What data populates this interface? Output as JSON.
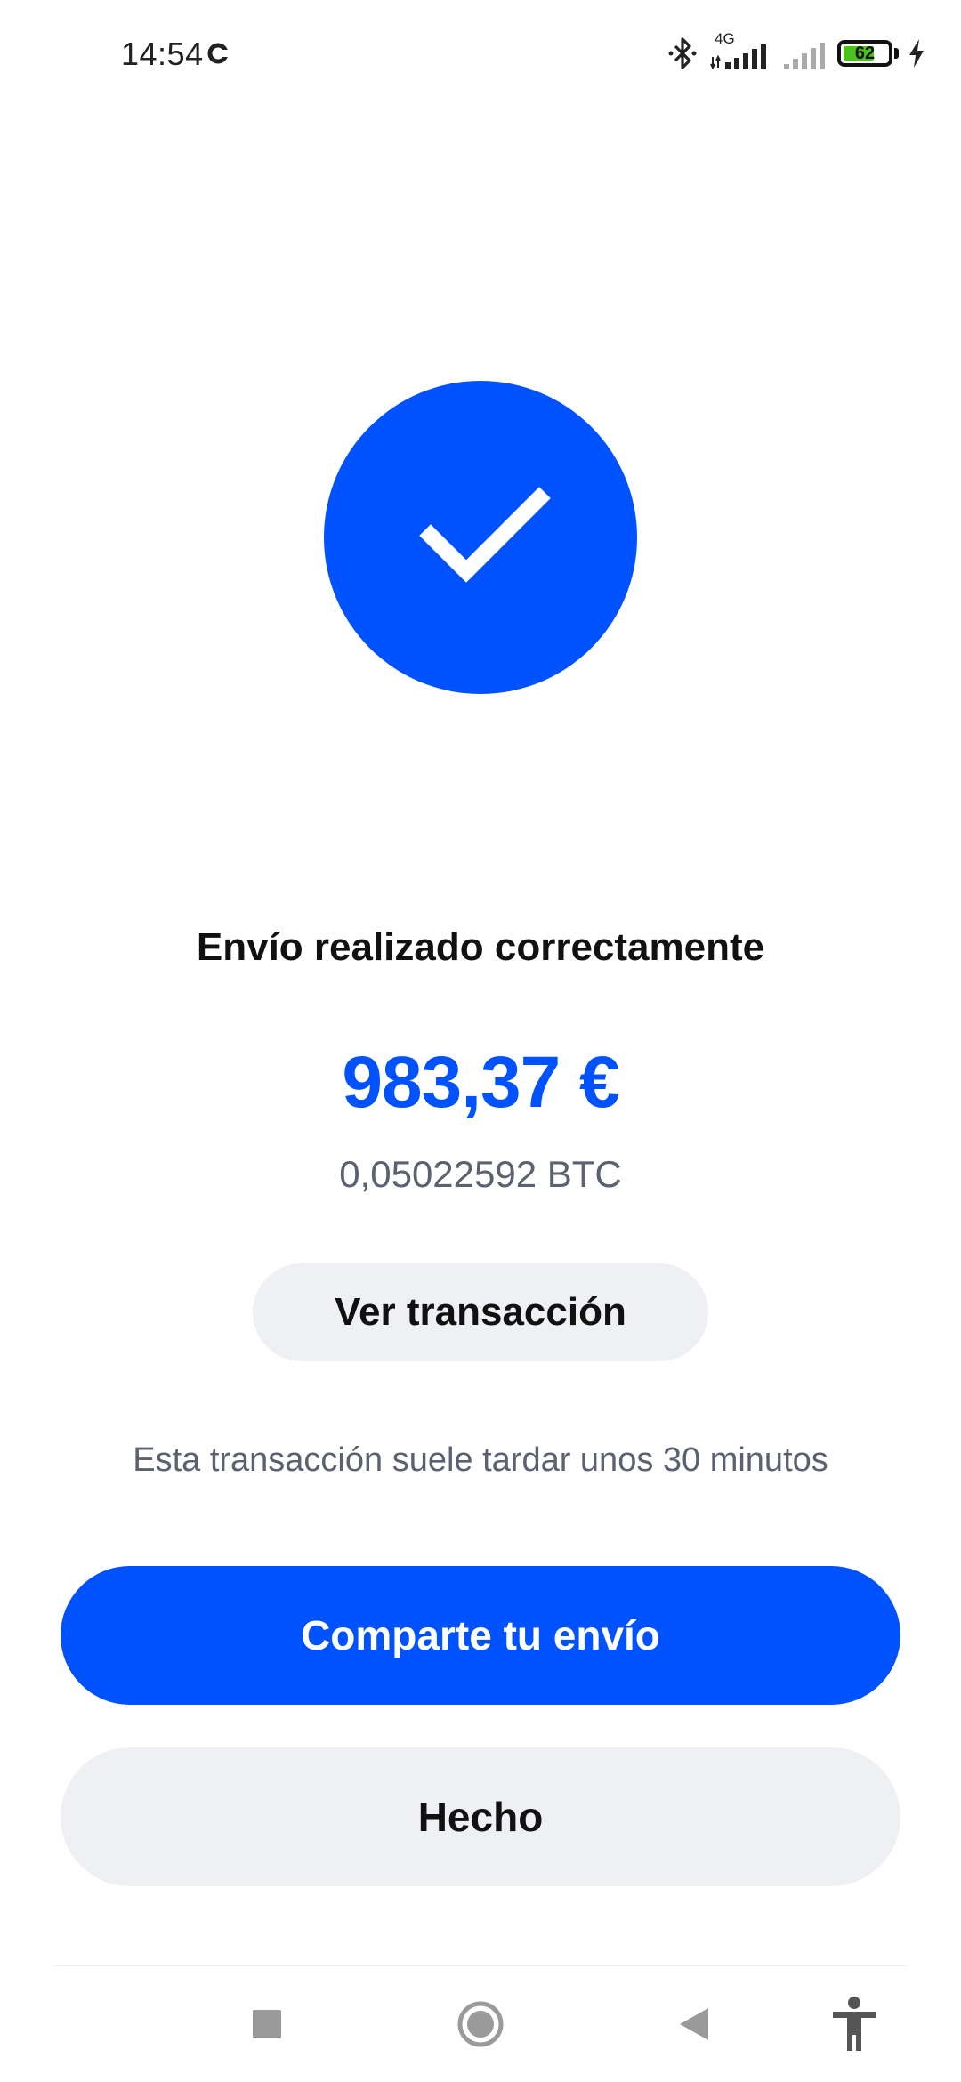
{
  "status_bar": {
    "time": "14:54",
    "network": "4G",
    "battery": "62",
    "icons": [
      "sync-icon",
      "bluetooth-icon",
      "signal-4g-icon",
      "signal-icon",
      "battery-icon",
      "charging-icon"
    ]
  },
  "success": {
    "icon": "checkmark-icon",
    "title": "Envío realizado correctamente",
    "amount_fiat": "983,37 €",
    "amount_crypto": "0,05022592 BTC"
  },
  "actions": {
    "view_transaction": "Ver transacción",
    "info": "Esta transacción suele tardar unos 30 minutos",
    "share": "Comparte tu envío",
    "done": "Hecho"
  },
  "nav": {
    "icons": [
      "recents-icon",
      "home-icon",
      "back-icon",
      "accessibility-icon"
    ]
  },
  "colors": {
    "accent": "#0052ff",
    "secondary_button": "#eef0f3",
    "muted_text": "#5b616e",
    "text": "#111111"
  }
}
